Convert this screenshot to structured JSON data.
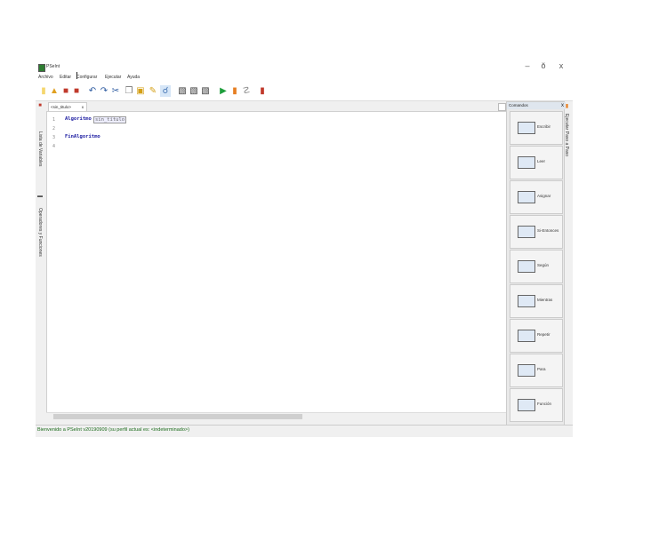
{
  "window": {
    "title": "PSeInt",
    "controls": {
      "minimize": "–",
      "maximize": "ŏ",
      "close": "x"
    }
  },
  "menu": [
    "Archivo",
    "Editar",
    "Configurar",
    "Ejecutar",
    "Ayuda"
  ],
  "toolbar": {
    "icons": [
      "new-file-icon",
      "open-folder-icon",
      "save-icon",
      "save-as-icon",
      "undo-icon",
      "redo-icon",
      "cut-icon",
      "copy-icon",
      "paste-icon",
      "edit-icon",
      "find-icon",
      "find-next-icon",
      "replace-icon",
      "indent-icon",
      "comment-icon",
      "run-icon",
      "step-by-step-icon",
      "debug-icon",
      "flowchart-icon"
    ],
    "tooltip": "Ejecutar paso a paso..."
  },
  "left_sidebar": {
    "panels": [
      "Lista de Variables",
      "Operadores y Funciones"
    ]
  },
  "editor": {
    "tab_label": "<sin_titulo>",
    "tab_close": "x",
    "lines": [
      {
        "num": "1",
        "keyword": "Algoritmo",
        "placeholder": "sin_titulo"
      },
      {
        "num": "2",
        "text": ""
      },
      {
        "num": "3",
        "keyword": "FinAlgoritmo"
      },
      {
        "num": "4",
        "text": ""
      }
    ]
  },
  "commands": {
    "title": "Comandos",
    "close": "x",
    "items": [
      {
        "label": "Escribir",
        "icon": "write-command-icon"
      },
      {
        "label": "Leer",
        "icon": "read-command-icon"
      },
      {
        "label": "Asignar",
        "icon": "assign-command-icon"
      },
      {
        "label": "Si-Entonces",
        "icon": "if-then-command-icon"
      },
      {
        "label": "Según",
        "icon": "switch-command-icon"
      },
      {
        "label": "Mientras",
        "icon": "while-command-icon"
      },
      {
        "label": "Repetir",
        "icon": "repeat-command-icon"
      },
      {
        "label": "Para",
        "icon": "for-command-icon"
      },
      {
        "label": "Función",
        "icon": "function-command-icon"
      }
    ]
  },
  "right_sidebar": {
    "label": "Ejecutar Paso a Paso"
  },
  "status": {
    "text": "Bienvenido a PSeInt v20190909 (su perfil actual es: <indeterminado>)"
  }
}
